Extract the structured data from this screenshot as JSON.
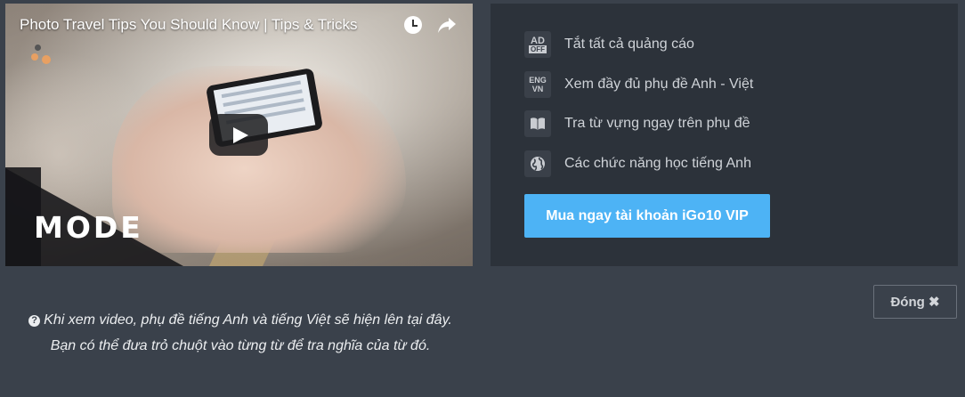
{
  "video": {
    "title": "Photo Travel Tips You Should Know | Tips & Tricks",
    "brand": "MODE",
    "icons": [
      "clock-icon",
      "share-icon",
      "play-icon"
    ]
  },
  "vip": {
    "features": [
      {
        "icon": "ad-off-icon",
        "icon_lines": [
          "AD",
          "OFF"
        ],
        "label": "Tắt tất cả quảng cáo"
      },
      {
        "icon": "eng-vn-icon",
        "icon_lines": [
          "ENG",
          "VN"
        ],
        "label": "Xem đầy đủ phụ đề Anh - Việt"
      },
      {
        "icon": "book-icon",
        "label": "Tra từ vựng ngay trên phụ đề"
      },
      {
        "icon": "globe-icon",
        "label": "Các chức năng học tiếng Anh"
      }
    ],
    "buy_label": "Mua ngay tài khoản iGo10 VIP"
  },
  "close_label": "Đóng ✖",
  "help": {
    "icon_glyph": "?",
    "line1": "Khi xem video, phụ đề tiếng Anh và tiếng Việt sẽ hiện lên tại đây.",
    "line2": "Bạn có thể đưa trỏ chuột vào từng từ để tra nghĩa của từ đó."
  },
  "colors": {
    "background": "#3a414b",
    "panel": "#2c323a",
    "accent": "#4db3f5"
  }
}
